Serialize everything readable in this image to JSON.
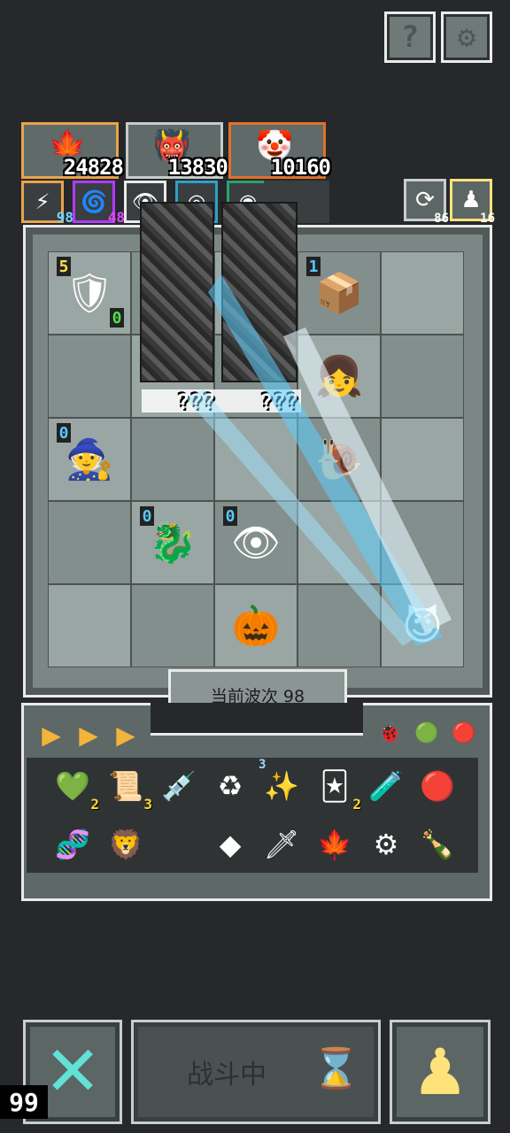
{
  "top_buttons": {
    "help_glyph": "?",
    "settings_glyph": "⚙"
  },
  "stats": [
    {
      "name": "maple-leaf",
      "value": "24828",
      "color": "#e9a44a",
      "icon": "🍁"
    },
    {
      "name": "blue-monster",
      "value": "13830",
      "color": "#c6ccca",
      "icon": "👹"
    },
    {
      "name": "clown-face",
      "value": "10160",
      "color": "#e0712a",
      "icon": "🤡"
    }
  ],
  "chips": [
    {
      "name": "pulse",
      "value": "98",
      "color": "#e9a44a",
      "num_color": "#6fd3ff",
      "icon": "⚡"
    },
    {
      "name": "magnet",
      "value": "48",
      "color": "#b13bff",
      "num_color": "#e048ff",
      "icon": "🌀"
    },
    {
      "name": "eye",
      "value": "",
      "color": "#e8ebe9",
      "num_color": "#ffffff",
      "icon": "👁"
    },
    {
      "name": "swirl",
      "value": "",
      "color": "#2ea0c8",
      "num_color": "#55ccff",
      "icon": "◎"
    },
    {
      "name": "ring",
      "value": "",
      "color": "#2aa36b",
      "num_color": "#44dd99",
      "icon": "◉"
    }
  ],
  "side_counters": [
    {
      "name": "refresh",
      "value": "86",
      "icon": "⟳",
      "border": "#c8cecc"
    },
    {
      "name": "pawn-gold",
      "value": "16",
      "icon": "♟",
      "border": "#ffe27a"
    }
  ],
  "board": {
    "units": [
      {
        "name": "knight-with-door",
        "icon": "🛡",
        "row": 0,
        "col": 0,
        "level": "5",
        "level_color": "#ffe14a",
        "badge": "0",
        "badge_color": "#4de04d"
      },
      {
        "name": "blue-box",
        "icon": "📦",
        "row": 0,
        "col": 3,
        "level": "1",
        "level_color": "#58c8ff"
      },
      {
        "name": "white-hair-girl",
        "icon": "👧",
        "row": 1,
        "col": 3
      },
      {
        "name": "old-wizard",
        "icon": "🧙",
        "row": 2,
        "col": 0,
        "level": "0",
        "level_color": "#58c8ff"
      },
      {
        "name": "dark-blob",
        "icon": "🐌",
        "row": 2,
        "col": 3
      },
      {
        "name": "fire-dragon",
        "icon": "🐉",
        "row": 3,
        "col": 1,
        "level": "0",
        "level_color": "#58c8ff"
      },
      {
        "name": "eye-monster",
        "icon": "👁",
        "row": 3,
        "col": 2,
        "level": "0",
        "level_color": "#58c8ff"
      },
      {
        "name": "pumpkin-brawler",
        "icon": "🎃",
        "row": 4,
        "col": 2
      },
      {
        "name": "imp-with-key",
        "icon": "😈",
        "row": 4,
        "col": 4
      }
    ],
    "unknown_labels": [
      "???",
      "???"
    ]
  },
  "wave_label": "当前波次 98",
  "inventory": {
    "tabs": [
      "▶",
      "▶",
      "▶"
    ],
    "filters": [
      "🐞",
      "🟢",
      "🔴"
    ],
    "row1": [
      {
        "name": "heart-gem",
        "icon": "💚",
        "count": "2"
      },
      {
        "name": "scroll",
        "icon": "📜",
        "count": "3"
      },
      {
        "name": "syringe",
        "icon": "💉",
        "count": ""
      },
      {
        "name": "recycle-jar",
        "icon": "♻",
        "count": ""
      },
      {
        "name": "star-sparkle",
        "icon": "✨",
        "count": "",
        "level": "3"
      },
      {
        "name": "wizard-card",
        "icon": "🃏",
        "count": "2"
      },
      {
        "name": "potion-flask",
        "icon": "🧪",
        "count": ""
      },
      {
        "name": "red-orb",
        "icon": "🔴",
        "count": ""
      }
    ],
    "row2": [
      {
        "name": "dna-helix",
        "icon": "🧬",
        "count": ""
      },
      {
        "name": "lion-shield",
        "icon": "🦁",
        "count": ""
      },
      {
        "name": "diamond-tile",
        "icon": "◆",
        "count": ""
      },
      {
        "name": "dagger",
        "icon": "🗡",
        "count": ""
      },
      {
        "name": "maple-leaf",
        "icon": "🍁",
        "count": ""
      },
      {
        "name": "gear-cog",
        "icon": "⚙",
        "count": ""
      },
      {
        "name": "green-bottle",
        "icon": "🍾",
        "count": ""
      }
    ]
  },
  "bottom": {
    "cancel_glyph": "✕",
    "battle_label": "战斗中",
    "hourglass_glyph": "⌛",
    "pawn_glyph": "♟",
    "speed_value": "99"
  }
}
